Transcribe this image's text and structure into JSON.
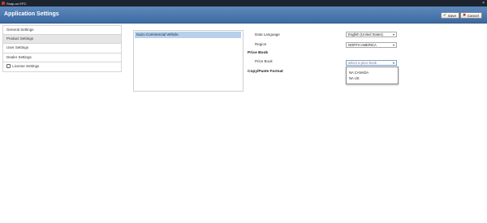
{
  "window": {
    "title": "Snap-on EPC",
    "app_icon": "app-icon",
    "close_glyph": "×"
  },
  "header": {
    "title": "Application Settings",
    "save": {
      "label": "Save",
      "icon": "check-icon"
    },
    "cancel": {
      "label": "Cancel",
      "icon": "x-icon"
    }
  },
  "sidebar": {
    "items": [
      {
        "label": "General Settings",
        "active": false
      },
      {
        "label": "Product Settings",
        "active": true
      },
      {
        "label": "User Settings",
        "active": false
      },
      {
        "label": "Dealer Settings",
        "active": false
      },
      {
        "label": "License Settings",
        "active": false,
        "icon": "lock-icon"
      }
    ]
  },
  "product": {
    "vehicle_list": [
      "Isuzu Commercial Vehicle"
    ],
    "data_language": {
      "label": "Data Language",
      "value": "English (United States)"
    },
    "region": {
      "label": "Region",
      "value": "NORTH AMERICA"
    },
    "price_book_section": "Price Book",
    "price_book": {
      "label": "Price Book",
      "placeholder": "select a price book"
    },
    "price_book_options": [
      "NA CANADA",
      "NA US"
    ],
    "copy_paste_section": "Copy/Paste Format"
  },
  "colors": {
    "header": "#4a78b0",
    "selected_row": "#b8d0ee",
    "title_bar": "#1c2430"
  }
}
